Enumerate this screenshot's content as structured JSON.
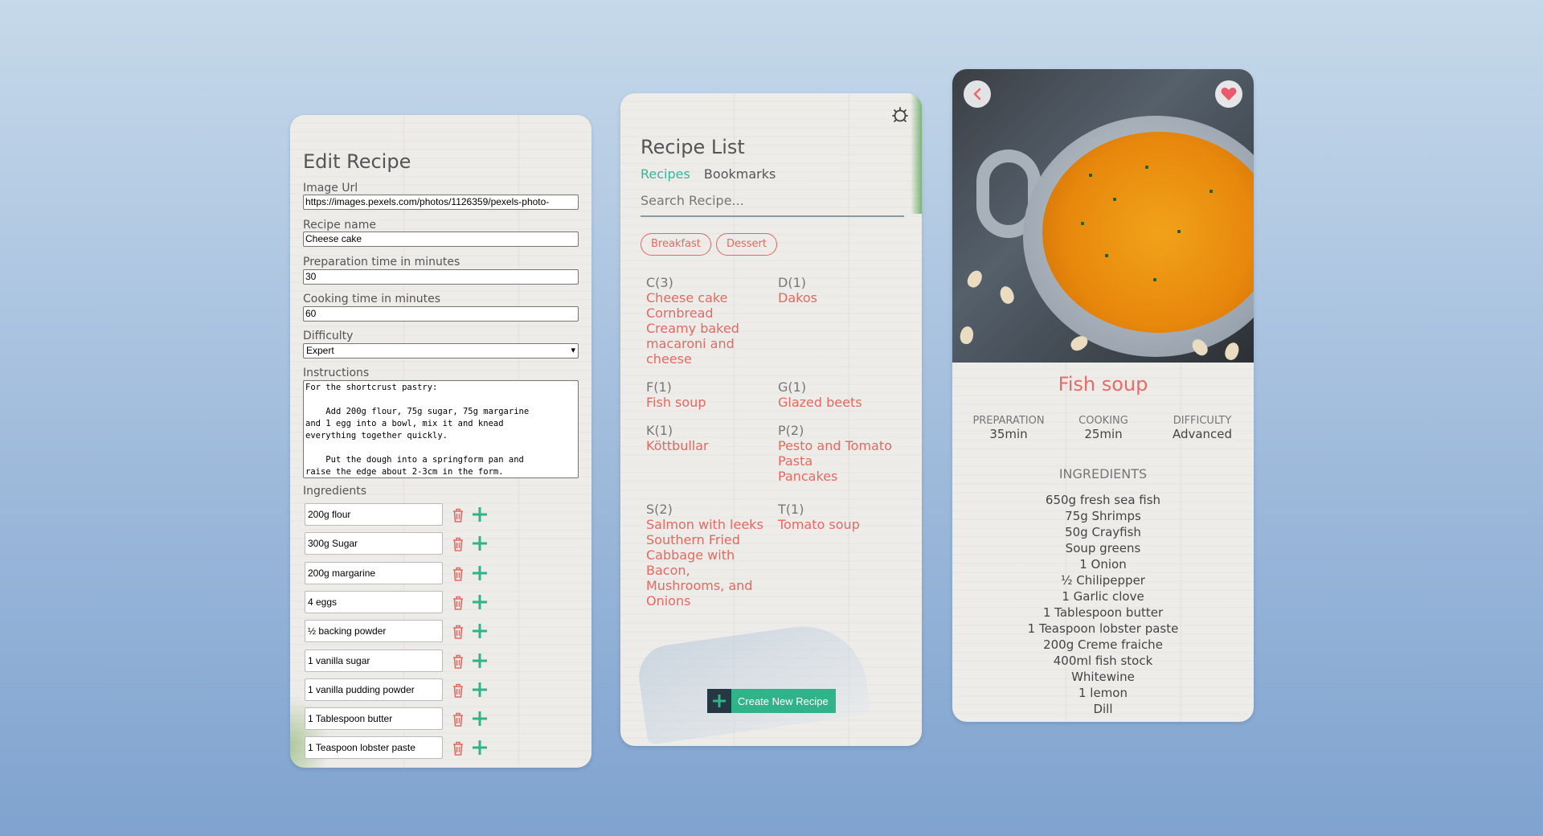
{
  "edit": {
    "title": "Edit Recipe",
    "image_url_label": "Image Url",
    "image_url_value": "https://images.pexels.com/photos/1126359/pexels-photo-",
    "name_label": "Recipe name",
    "name_value": "Cheese cake",
    "prep_label": "Preparation time in minutes",
    "prep_value": "30",
    "cook_label": "Cooking time in minutes",
    "cook_value": "60",
    "difficulty_label": "Difficulty",
    "difficulty_value": "Expert",
    "instructions_label": "Instructions",
    "instructions_value": "For the shortcrust pastry:\n\n    Add 200g flour, 75g sugar, 75g margarine\nand 1 egg into a bowl, mix it and knead\neverything together quickly.\n\n    Put the dough into a springform pan and\nraise the edge about 2-3cm in the form.",
    "ingredients_label": "Ingredients",
    "ingredients": [
      "200g flour",
      "300g Sugar",
      "200g margarine",
      "4 eggs",
      "½ backing powder",
      "1 vanilla sugar",
      "1 vanilla pudding powder",
      "1 Tablespoon butter",
      "1 Teaspoon lobster paste"
    ]
  },
  "list": {
    "title": "Recipe List",
    "tab_recipes": "Recipes",
    "tab_bookmarks": "Bookmarks",
    "search_placeholder": "Search Recipe...",
    "chips": [
      "Breakfast",
      "Dessert"
    ],
    "groups": [
      {
        "head": "C(3)",
        "items": [
          "Cheese cake",
          "Cornbread",
          "Creamy baked",
          "macaroni and",
          "cheese"
        ]
      },
      {
        "head": "D(1)",
        "items": [
          "Dakos"
        ]
      },
      {
        "head": "F(1)",
        "items": [
          "Fish soup"
        ]
      },
      {
        "head": "G(1)",
        "items": [
          "Glazed beets"
        ]
      },
      {
        "head": "K(1)",
        "items": [
          "Köttbullar"
        ]
      },
      {
        "head": "P(2)",
        "items": [
          "Pesto and Tomato",
          "Pasta",
          "Pancakes"
        ]
      },
      {
        "head": "S(2)",
        "items": [
          "Salmon with leeks",
          "Southern Fried",
          "Cabbage with",
          "Bacon,",
          "Mushrooms, and",
          "Onions"
        ]
      },
      {
        "head": "T(1)",
        "items": [
          "Tomato soup"
        ]
      }
    ],
    "create_button": "Create New Recipe"
  },
  "detail": {
    "title": "Fish soup",
    "prep_label": "PREPARATION",
    "prep_value": "35min",
    "cook_label": "COOKING",
    "cook_value": "25min",
    "difficulty_label": "DIFFICULTY",
    "difficulty_value": "Advanced",
    "ingredients_heading": "INGREDIENTS",
    "ingredients": [
      "650g fresh sea fish",
      "75g Shrimps",
      "50g Crayfish",
      "Soup greens",
      "1 Onion",
      "½ Chilipepper",
      "1 Garlic clove",
      "1 Tablespoon butter",
      "1 Teaspoon lobster paste",
      "200g Creme fraiche",
      "400ml fish stock",
      "Whitewine",
      "1 lemon",
      "Dill"
    ]
  },
  "icons": {
    "trash": "trash-icon",
    "plus": "plus-icon",
    "settings": "bug-settings-icon",
    "back": "chevron-left-icon",
    "favorite": "heart-icon"
  },
  "colors": {
    "accent_green": "#31b38a",
    "accent_red": "#e26a62",
    "title_red": "#ea6a6a",
    "tab_active": "#3cb39a"
  }
}
